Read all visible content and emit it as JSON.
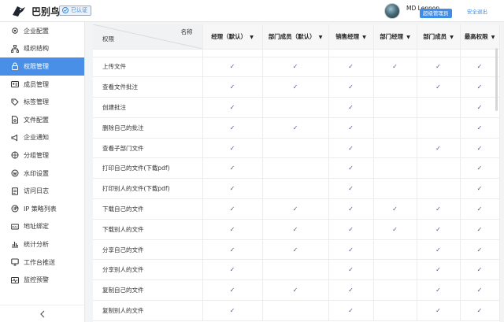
{
  "topbar": {
    "brand": "巴别鸟",
    "verified": "已认证",
    "user_name": "MD Lennon",
    "role_badge": "超级管理员",
    "logout": "安全退出"
  },
  "sidebar": {
    "items": [
      {
        "label": "企业配置",
        "icon": "gear-icon"
      },
      {
        "label": "组织结构",
        "icon": "org-icon"
      },
      {
        "label": "权限管理",
        "icon": "lock-icon",
        "active": true
      },
      {
        "label": "成员管理",
        "icon": "id-card-icon"
      },
      {
        "label": "标签管理",
        "icon": "tag-icon"
      },
      {
        "label": "文件配置",
        "icon": "file-settings-icon"
      },
      {
        "label": "企业通知",
        "icon": "megaphone-icon"
      },
      {
        "label": "分组管理",
        "icon": "group-icon"
      },
      {
        "label": "水印设置",
        "icon": "watermark-icon"
      },
      {
        "label": "访问日志",
        "icon": "log-icon"
      },
      {
        "label": "IP 策略列表",
        "icon": "ip-icon"
      },
      {
        "label": "地址绑定",
        "icon": "mac-icon"
      },
      {
        "label": "统计分析",
        "icon": "chart-icon"
      },
      {
        "label": "工作台推送",
        "icon": "push-icon"
      },
      {
        "label": "监控预警",
        "icon": "monitor-icon"
      }
    ],
    "collapse_icon": "chevron-left-icon"
  },
  "table": {
    "corner_name": "名称",
    "corner_perm": "权限",
    "columns": [
      "经理（默认）",
      "部门成员（默认）",
      "销售经理",
      "部门经理",
      "部门成员",
      "最高权限"
    ],
    "check_glyph": "✓",
    "rows": [
      {
        "label": "上传文件",
        "checks": [
          true,
          true,
          true,
          true,
          true,
          true
        ]
      },
      {
        "label": "查看文件批注",
        "checks": [
          true,
          true,
          true,
          false,
          true,
          true
        ]
      },
      {
        "label": "创建批注",
        "checks": [
          true,
          false,
          true,
          false,
          false,
          true
        ]
      },
      {
        "label": "删除自己的批注",
        "checks": [
          true,
          true,
          true,
          false,
          false,
          true
        ]
      },
      {
        "label": "查看子部门文件",
        "checks": [
          true,
          false,
          true,
          false,
          true,
          true
        ]
      },
      {
        "label": "打印自己的文件(下载pdf)",
        "checks": [
          true,
          false,
          true,
          false,
          false,
          true
        ]
      },
      {
        "label": "打印别人的文件(下载pdf)",
        "checks": [
          true,
          false,
          true,
          false,
          false,
          true
        ]
      },
      {
        "label": "下载自己的文件",
        "checks": [
          true,
          true,
          true,
          true,
          true,
          true
        ]
      },
      {
        "label": "下载别人的文件",
        "checks": [
          true,
          true,
          true,
          true,
          true,
          true
        ]
      },
      {
        "label": "分享自己的文件",
        "checks": [
          true,
          true,
          true,
          false,
          true,
          true
        ]
      },
      {
        "label": "分享别人的文件",
        "checks": [
          true,
          false,
          true,
          false,
          true,
          true
        ]
      },
      {
        "label": "复制自己的文件",
        "checks": [
          true,
          true,
          true,
          false,
          true,
          true
        ]
      },
      {
        "label": "复制别人的文件",
        "checks": [
          true,
          false,
          true,
          false,
          true,
          true
        ]
      }
    ]
  }
}
